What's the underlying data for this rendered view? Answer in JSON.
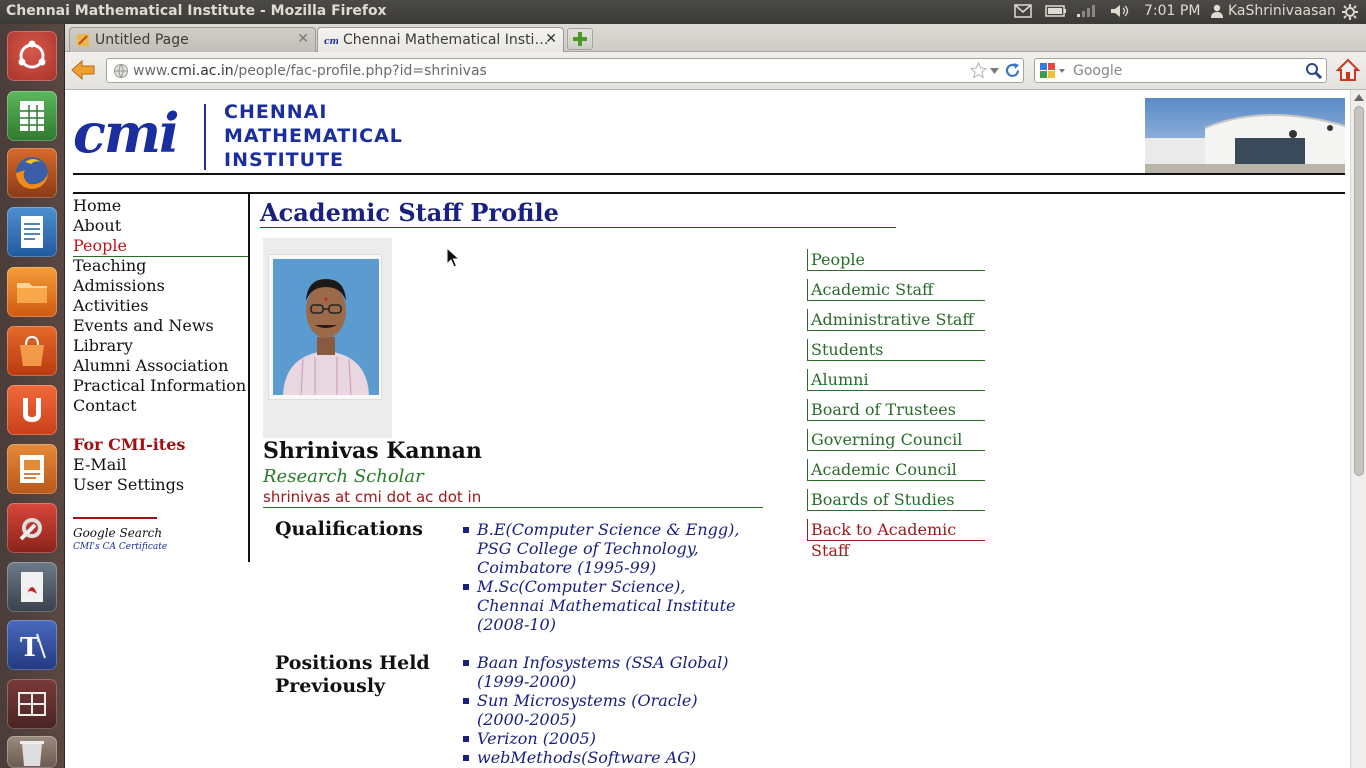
{
  "window": {
    "title": "Chennai Mathematical Institute - Mozilla Firefox"
  },
  "top_panel": {
    "clock": "7:01 PM",
    "user": "KaShrinivaasan",
    "icons": [
      "mail-icon",
      "battery-icon",
      "network-icon",
      "volume-icon",
      "user-icon",
      "settings-gear-icon"
    ]
  },
  "launcher": {
    "items": [
      "ubuntu-dash-icon",
      "spreadsheet-icon",
      "firefox-icon",
      "document-writer-icon",
      "files-icon",
      "software-center-icon",
      "ubuntu-one-icon",
      "impress-icon",
      "system-settings-icon",
      "pdf-viewer-icon",
      "tex-editor-icon",
      "workspaces-icon",
      "trash-icon"
    ]
  },
  "tabs": [
    {
      "label": "Untitled Page",
      "active": false
    },
    {
      "label": "Chennai Mathematical Insti…",
      "active": true
    }
  ],
  "navbar": {
    "url_prefix": "www.",
    "url_domain": "cmi.ac.in",
    "url_path": "/people/fac-profile.php?id=shrinivas",
    "search_placeholder": "Google"
  },
  "site": {
    "logo_mark": "cmi",
    "logo_text": [
      "CHENNAI",
      "MATHEMATICAL",
      "INSTITUTE"
    ]
  },
  "left_nav": {
    "items": [
      "Home",
      "About",
      "People",
      "Teaching",
      "Admissions",
      "Activities",
      "Events and News",
      "Library",
      "Alumni Association",
      "Practical Information",
      "Contact"
    ],
    "active": "People",
    "cmi_heading": "For CMI-ites",
    "cmi_items": [
      "E-Mail",
      "User Settings"
    ],
    "google_search": "Google Search",
    "ca_certificate": "CMI's CA Certificate"
  },
  "profile": {
    "page_title": "Academic Staff Profile",
    "name": "Shrinivas Kannan",
    "role": "Research Scholar",
    "email": "shrinivas at cmi dot ac dot in",
    "qualifications_heading": "Qualifications",
    "qualifications": [
      "B.E(Computer Science & Engg), PSG College of Technology, Coimbatore (1995-99)",
      "M.Sc(Computer Science), Chennai Mathematical Institute (2008-10)"
    ],
    "positions_heading": [
      "Positions Held",
      "Previously"
    ],
    "positions": [
      "Baan Infosystems (SSA Global) (1999-2000)",
      "Sun Microsystems (Oracle) (2000-2005)",
      "Verizon (2005)",
      "webMethods(Software AG)"
    ]
  },
  "right_nav": {
    "items": [
      "People",
      "Academic Staff",
      "Administrative Staff",
      "Students",
      "Alumni",
      "Board of Trustees",
      "Governing Council",
      "Academic Council",
      "Boards of Studies"
    ],
    "back": "Back to Academic Staff"
  }
}
